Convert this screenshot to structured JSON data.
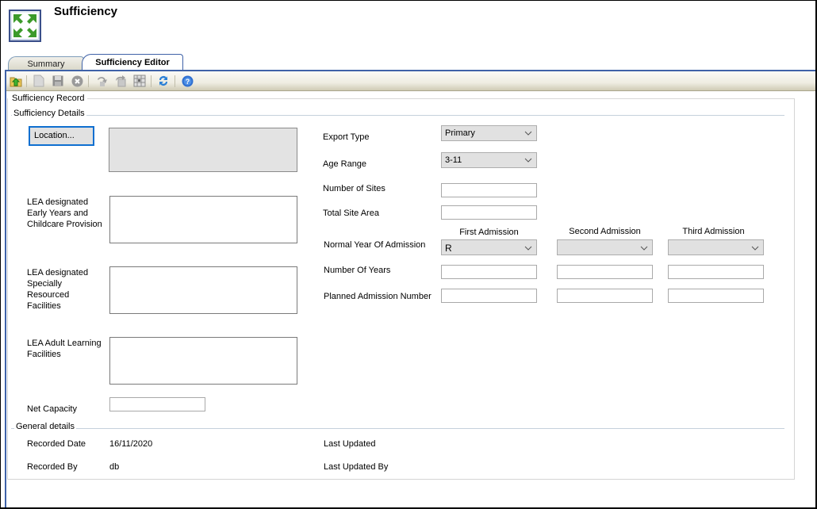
{
  "app": {
    "title": "Sufficiency",
    "icon": "expand-arrows-icon"
  },
  "tabs": [
    {
      "label": "Summary",
      "active": false
    },
    {
      "label": "Sufficiency Editor",
      "active": true
    }
  ],
  "toolbar": {
    "buttons": [
      {
        "icon": "open-folder-up-icon",
        "enabled": true
      },
      {
        "icon": "new-document-icon",
        "enabled": false
      },
      {
        "icon": "save-icon",
        "enabled": false
      },
      {
        "icon": "cancel-icon",
        "enabled": false
      },
      {
        "icon": "undo-icon",
        "enabled": false
      },
      {
        "icon": "export-icon",
        "enabled": false
      },
      {
        "icon": "grid-icon",
        "enabled": false
      },
      {
        "icon": "refresh-icon",
        "enabled": true
      },
      {
        "icon": "help-icon",
        "enabled": true
      }
    ]
  },
  "record": {
    "title": "Sufficiency Record",
    "details_title": "Sufficiency Details",
    "location_button": "Location...",
    "location_value": "",
    "early_years_label": "LEA designated Early Years and Childcare Provision",
    "early_years_lines": [
      "LEA designated",
      "Early Years and",
      "Childcare Provision"
    ],
    "early_years_value": "",
    "specially_resourced_lines": [
      "LEA designated",
      "Specially",
      "Resourced",
      "Facilities"
    ],
    "specially_resourced_value": "",
    "adult_learning_lines": [
      "LEA Adult Learning",
      "Facilities"
    ],
    "adult_learning_value": "",
    "net_capacity_label": "Net Capacity",
    "net_capacity_value": "",
    "export_type_label": "Export Type",
    "export_type_value": "Primary",
    "age_range_label": "Age Range",
    "age_range_value": "3-11",
    "number_of_sites_label": "Number of Sites",
    "number_of_sites_value": "",
    "total_site_area_label": "Total Site Area",
    "total_site_area_value": "",
    "admissions": {
      "columns": [
        "First Admission",
        "Second Admission",
        "Third Admission"
      ],
      "normal_year_label": "Normal Year Of Admission",
      "normal_year_values": [
        "R",
        "",
        ""
      ],
      "number_of_years_label": "Number Of Years",
      "number_of_years_values": [
        "",
        "",
        ""
      ],
      "pan_label": "Planned Admission Number",
      "pan_values": [
        "",
        "",
        ""
      ]
    }
  },
  "general": {
    "title": "General details",
    "recorded_date_label": "Recorded Date",
    "recorded_date_value": "16/11/2020",
    "recorded_by_label": "Recorded By",
    "recorded_by_value": "db",
    "last_updated_label": "Last Updated",
    "last_updated_value": "",
    "last_updated_by_label": "Last Updated By",
    "last_updated_by_value": ""
  }
}
